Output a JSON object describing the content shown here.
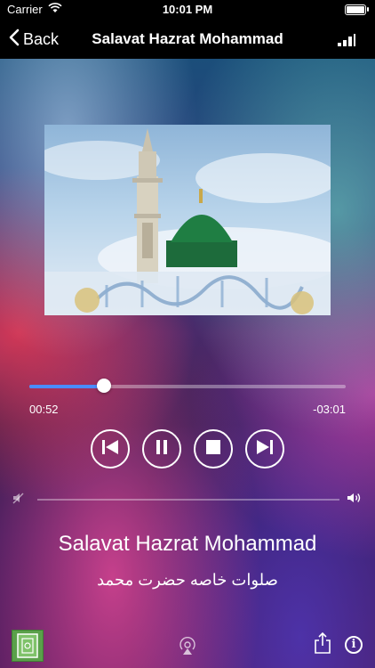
{
  "status_bar": {
    "carrier": "Carrier",
    "time": "10:01 PM",
    "wifi_icon": "wifi-icon",
    "battery_icon": "battery-icon"
  },
  "nav": {
    "back_label": "Back",
    "title": "Salavat Hazrat Mohammad",
    "signal_icon": "signal-bars-icon"
  },
  "player": {
    "progress": 0.235,
    "elapsed": "00:52",
    "remaining": "-03:01",
    "controls": [
      "previous-icon",
      "pause-icon",
      "stop-icon",
      "next-icon"
    ],
    "volume_level": 0.0,
    "accent_color": "#4a8cff"
  },
  "track": {
    "title": "Salavat Hazrat Mohammad",
    "subtitle": "صلوات خاصه حضرت محمد"
  },
  "bottom_bar": {
    "icons": [
      "quran-app-icon",
      "airplay-icon",
      "share-icon",
      "info-icon"
    ]
  }
}
